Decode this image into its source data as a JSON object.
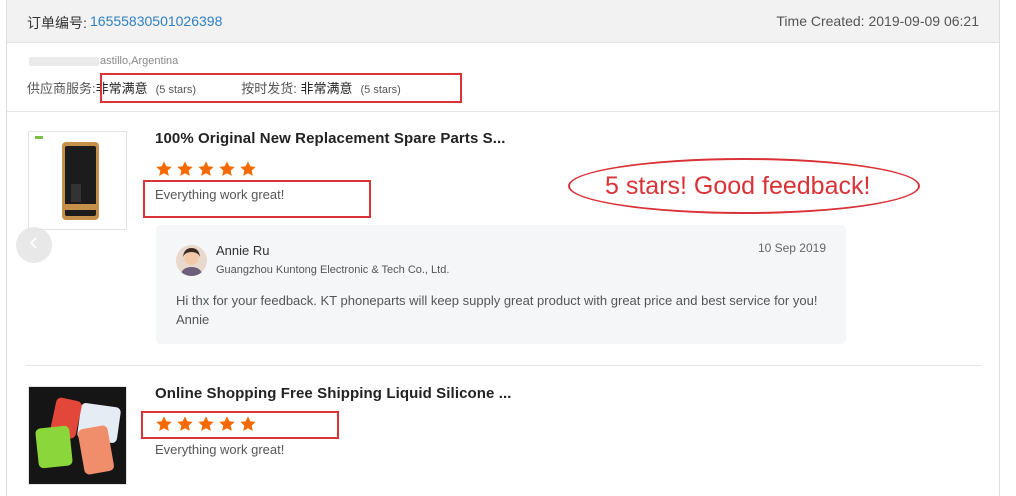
{
  "order": {
    "label": "订单编号:",
    "number": "16555830501026398",
    "time_created": "Time Created: 2019-09-09 06:21"
  },
  "buyer": {
    "location": "astillo,Argentina"
  },
  "seller_ratings": {
    "service_label": "供应商服务:",
    "service_value": "非常满意",
    "service_stars": "(5 stars)",
    "shipping_label": "按时发货:",
    "shipping_value": "非常满意",
    "shipping_stars": "(5 stars)"
  },
  "products": [
    {
      "title": "100% Original New Replacement Spare Parts S...",
      "rating": 5,
      "max_rating": 5,
      "review": "Everything work great!",
      "reply": {
        "name": "Annie Ru",
        "company": "Guangzhou Kuntong Electronic & Tech Co., Ltd.",
        "date": "10 Sep 2019",
        "text": "Hi thx for your feedback. KT phoneparts will keep supply great product with great price and best service for you!  Annie"
      }
    },
    {
      "title": "Online Shopping Free Shipping Liquid Silicone ...",
      "rating": 5,
      "max_rating": 5,
      "review": "Everything work great!"
    }
  ],
  "annotation": {
    "text": "5 stars! Good feedback!"
  },
  "icons": {
    "star": "star-icon",
    "prev": "chevron-left-icon"
  },
  "colors": {
    "link": "#2f7fc1",
    "star": "#f56a00",
    "annotation": "#d93237"
  }
}
